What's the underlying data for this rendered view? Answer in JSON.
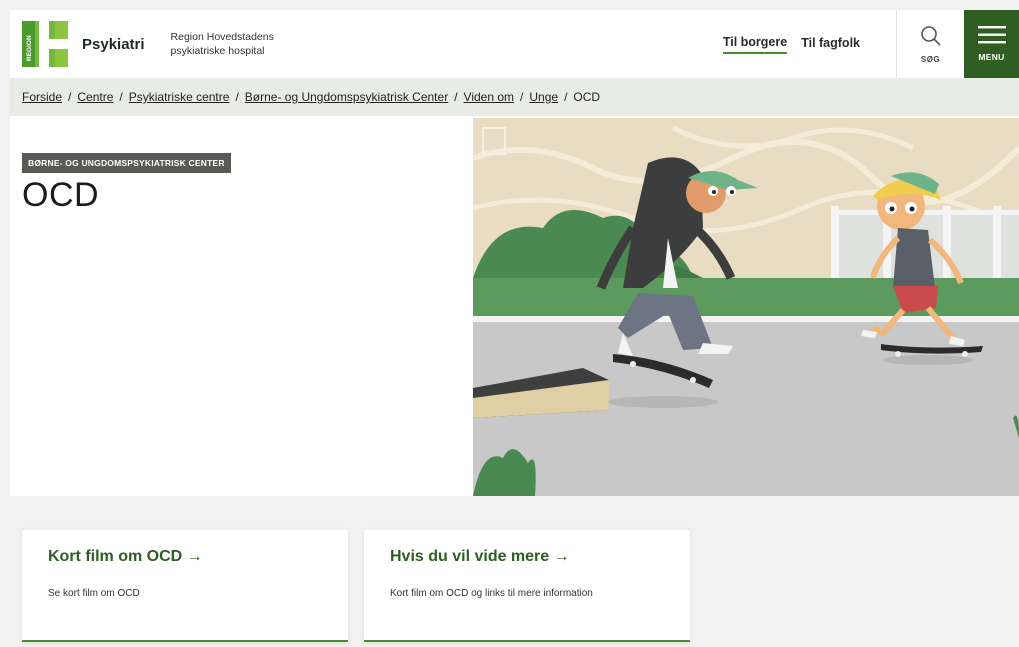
{
  "header": {
    "logo_letter": "REGION",
    "brand": "Psykiatri",
    "subtitle_line1": "Region Hovedstadens",
    "subtitle_line2": "psykiatriske hospital",
    "nav": [
      {
        "label": "Til borgere",
        "active": true
      },
      {
        "label": "Til fagfolk",
        "active": false
      }
    ],
    "search_label": "SØG",
    "menu_label": "MENU"
  },
  "breadcrumb": {
    "items": [
      "Forside",
      "Centre",
      "Psykiatriske centre",
      "Børne- og Ungdomspsykiatrisk Center",
      "Viden om",
      "Unge"
    ],
    "current": "OCD"
  },
  "main": {
    "badge": "BØRNE- OG UNGDOMSPSYKIATRISK CENTER",
    "title": "OCD",
    "hero_alt": "Illustration af to unge på skateboard"
  },
  "cards": [
    {
      "title": "Kort film om OCD →",
      "text": "Se kort film om OCD"
    },
    {
      "title": "Hvis du vil vide mere →",
      "text": "Kort film om OCD og links til mere information"
    }
  ],
  "colors": {
    "brand_green": "#2e5e22",
    "accent_green": "#4c8a2e",
    "logo_green": "#76b83e"
  }
}
